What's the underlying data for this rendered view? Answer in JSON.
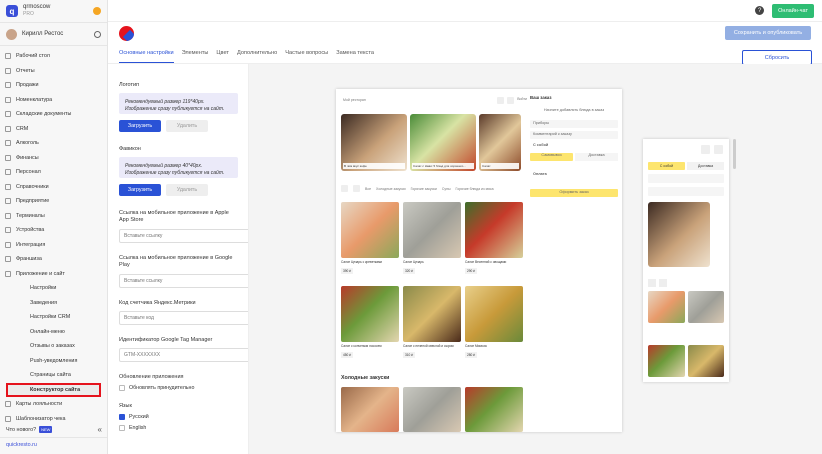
{
  "sidebar": {
    "org": "qrmoscow",
    "plan": "PRO",
    "user": "Кирилл Рестос",
    "items": [
      "Рабочий стол",
      "Отчеты",
      "Продажи",
      "Номенклатура",
      "Складские документы",
      "CRM",
      "Алкоголь",
      "Финансы",
      "Персонал",
      "Справочники",
      "Предприятие",
      "Терминалы",
      "Устройства",
      "Интеграция",
      "Франшиза",
      "Приложение и сайт"
    ],
    "subitems": [
      "Настройки",
      "Заведения",
      "Настройки CRM",
      "Онлайн-меню",
      "Отзывы о заказах",
      "Push-уведомления",
      "Страницы сайта",
      "Конструктор сайта"
    ],
    "after": [
      "Карты лояльности",
      "Шаблонизатор чека"
    ],
    "whats_new": "Что нового?",
    "new_badge": "NEW",
    "domain": "quickresto.ru"
  },
  "topbar": {
    "help": "?",
    "chat": "Онлайн-чат"
  },
  "publish": "Сохранить и опубликовать",
  "tabs": [
    "Основные настройки",
    "Элементы",
    "Цвет",
    "Дополнительно",
    "Частые вопросы",
    "Замена текста"
  ],
  "reset": "Сбросить",
  "form": {
    "logo_label": "Логотип",
    "logo_hint": "Рекомендуемый размер 119*40px. Изображение сразу публикуется на сайт.",
    "upload": "Загрузить",
    "delete": "Удалить",
    "favicon_label": "Фавикон",
    "favicon_hint": "Рекомендуемый размер 40*40px. Изображение сразу публикуется на сайт.",
    "apple_label": "Ссылка на мобильное приложение в Apple App Store",
    "google_label": "Ссылка на мобильное приложение в Google Play",
    "link_ph": "Вставьте ссылку",
    "metrika_label": "Код счетчика Яндекс.Метрики",
    "code_ph": "Вставьте код",
    "gtm_label": "Идентификатор Google Tag Manager",
    "gtm_ph": "GTM-XXXXXXX",
    "update_label": "Обновление приложения",
    "update_check": "Обновлять принудительно",
    "lang_label": "Язык",
    "lang_ru": "Русский",
    "lang_en": "English"
  },
  "desk": {
    "header": "Мой ресторан",
    "login": "Войти",
    "stories": [
      "В чём вкус кофе",
      "Салат с Нави: 5 блюд для хорошего...",
      "Салат"
    ],
    "cart_title": "Ваш заказ",
    "cart_empty": "Начните добавлять блюда в заказ",
    "cart_rows": [
      "Приборы",
      "Комментарий к заказу",
      "С собой",
      "Самовывоз",
      "Доставка",
      "Оплата"
    ],
    "cart_btn": "Оформить заказ",
    "cats": [
      "Все",
      "Холодные закуски",
      "Горячие закуски",
      "Супы",
      "Горячие блюда из мяса"
    ],
    "dishes": [
      {
        "n": "Салат Цезарь с креветками",
        "p": "390 ₽"
      },
      {
        "n": "Салат Цезарь",
        "p": "320 ₽"
      },
      {
        "n": "Салат Весенний с овощами",
        "p": "290 ₽"
      },
      {
        "n": "Салат с копченым лососем",
        "p": "450 ₽"
      },
      {
        "n": "Салат с печеной свеклой и сыром",
        "p": "310 ₽"
      },
      {
        "n": "Салат Мимоза",
        "p": "280 ₽"
      }
    ],
    "section": "Холодные закуски"
  }
}
